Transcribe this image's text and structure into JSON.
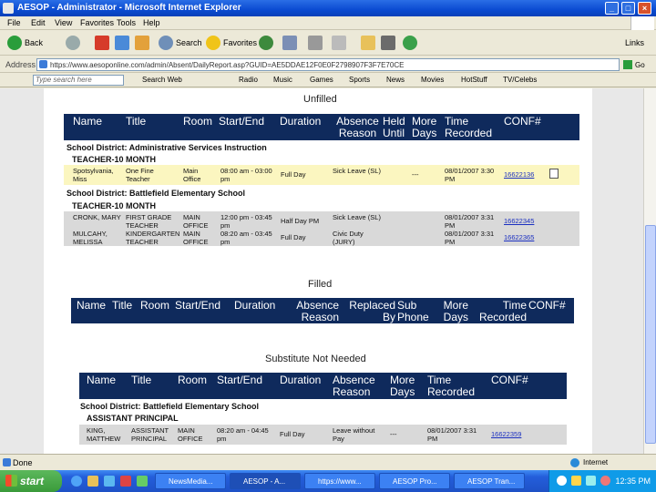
{
  "window": {
    "title": "AESOP - Administrator - Microsoft Internet Explorer"
  },
  "menu": [
    "File",
    "Edit",
    "View",
    "Favorites",
    "Tools",
    "Help"
  ],
  "toolbar": {
    "back": "Back",
    "search": "Search",
    "favorites": "Favorites",
    "links": "Links"
  },
  "address": {
    "label": "Address",
    "url": "https://www.aesoponline.com/admin/Absent/DailyReport.asp?GUID=AE5DDAE12F0E0F2798907F3F7E70CE",
    "go": "Go"
  },
  "linksbar": {
    "search_placeholder": "Type search here",
    "items": [
      "Search Web",
      "Radio",
      "Music",
      "Games",
      "Sports",
      "News",
      "Movies",
      "HotStuff",
      "TV/Celebs"
    ]
  },
  "unfilled": {
    "title": "Unfilled",
    "columns": [
      "Name",
      "Title",
      "Room",
      "Start/End",
      "Duration",
      "Absence Reason",
      "Held Until",
      "More Days",
      "Time Recorded",
      "CONF#"
    ],
    "groups": [
      {
        "district": "School District: Administrative Services Instruction",
        "position": "TEACHER-10 MONTH",
        "rows": [
          {
            "name": "Spotsylvania, Miss",
            "title": "One Fine Teacher",
            "room": "Main Office",
            "time": "08:00 am - 03:00 pm",
            "duration": "Full Day",
            "reason": "Sick Leave (SL)",
            "held": "---",
            "recorded": "08/01/2007 3:30 PM",
            "conf": "16622136"
          }
        ]
      },
      {
        "district": "School District: Battlefield Elementary School",
        "position": "TEACHER-10 MONTH",
        "rows": [
          {
            "name": "CRONK, MARY",
            "title": "FIRST GRADE TEACHER",
            "room": "MAIN OFFICE",
            "time": "12:00 pm - 03:45 pm",
            "duration": "Half Day PM",
            "reason": "Sick Leave (SL)",
            "held": "",
            "recorded": "08/01/2007 3:31 PM",
            "conf": "16622345"
          },
          {
            "name": "MULCAHY, MELISSA",
            "title": "KINDERGARTEN TEACHER",
            "room": "MAIN OFFICE",
            "time": "08:20 am - 03:45 pm",
            "duration": "Full Day",
            "reason": "Civic Duty (JURY)",
            "held": "",
            "recorded": "08/01/2007 3:31 PM",
            "conf": "16622365"
          }
        ]
      }
    ]
  },
  "filled": {
    "title": "Filled",
    "columns": [
      "Name",
      "Title",
      "Room",
      "Start/End",
      "Duration",
      "Absence Reason",
      "Replaced By",
      "Sub Phone",
      "More Days",
      "Time Recorded",
      "CONF#"
    ]
  },
  "not_needed": {
    "title": "Substitute Not Needed",
    "columns": [
      "Name",
      "Title",
      "Room",
      "Start/End",
      "Duration",
      "Absence Reason",
      "More Days",
      "Time Recorded",
      "CONF#"
    ],
    "district": "School District: Battlefield Elementary School",
    "position": "ASSISTANT PRINCIPAL",
    "rows": [
      {
        "name": "KING, MATTHEW",
        "title": "ASSISTANT PRINCIPAL",
        "room": "MAIN OFFICE",
        "time": "08:20 am - 04:45 pm",
        "duration": "Full Day",
        "reason": "Leave without Pay",
        "more": "---",
        "recorded": "08/01/2007 3:31 PM",
        "conf": "16622359"
      }
    ]
  },
  "status": {
    "text": "Done",
    "zone": "Internet"
  },
  "taskbar": {
    "start": "start",
    "tasks": [
      "NewsMedia...",
      "AESOP - A...",
      "https://www...",
      "AESOP Pro...",
      "AESOP Tran..."
    ],
    "clock": "12:35 PM"
  },
  "colors": {
    "header_navy": "#0f2a5c",
    "highlight_yellow": "#fbf6c0",
    "row_gray": "#d9d9d9"
  }
}
